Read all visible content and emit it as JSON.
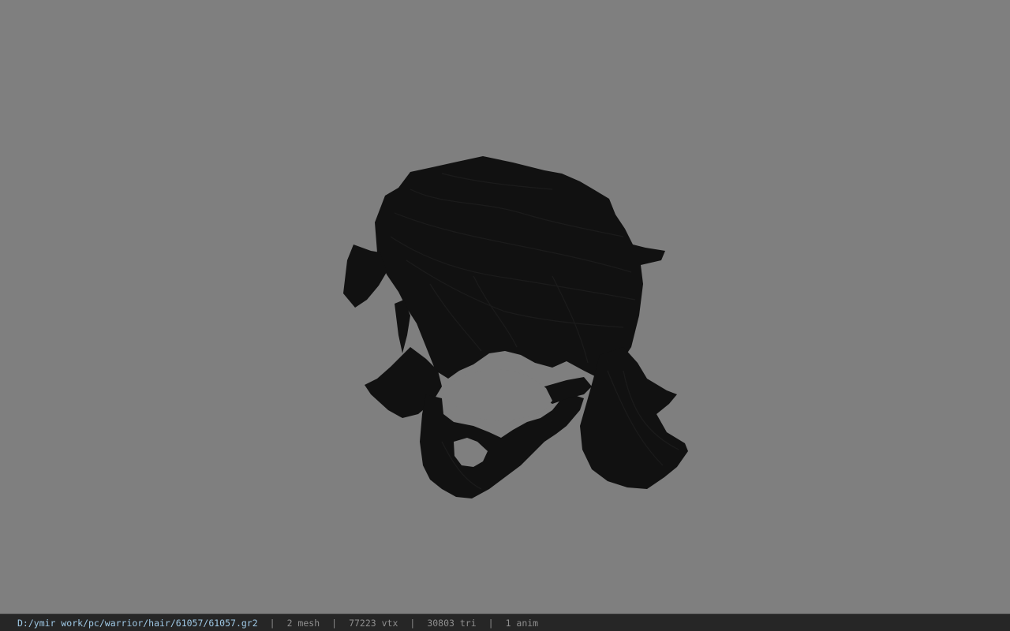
{
  "viewer": {
    "background_color": "#7f7f7f",
    "model_color": "#111111"
  },
  "status_bar": {
    "file_path": "D:/ymir work/pc/warrior/hair/61057/61057.gr2",
    "mesh_count": "2 mesh",
    "vertex_count": "77223 vtx",
    "triangle_count": "30803 tri",
    "anim_count": "1 anim",
    "separator": "|",
    "path_color": "#9fc9e6",
    "text_color": "#8f8f8f"
  }
}
